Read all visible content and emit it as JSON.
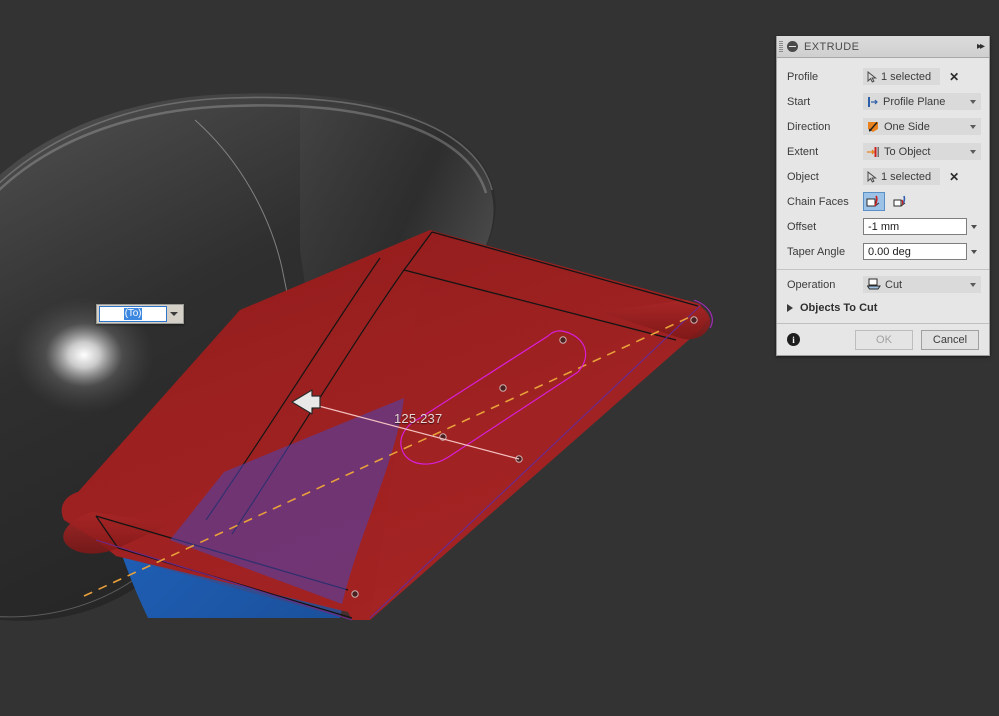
{
  "viewport": {
    "background_color": "#333333",
    "canvas_input": {
      "value": "(To)",
      "placeholder": "(To)",
      "dropdown_icon": "chevron-down-icon"
    },
    "dimension_label": "125.237",
    "manipulator": "arrow-left-handle",
    "colors": {
      "selected_face": "#1f61b5",
      "preview_body": "#9e2020",
      "profile_magenta": "#d81fd8",
      "axis_orange": "#e8a03a",
      "dimension_line": "#f4c0c0",
      "body_grey": "#3a3a3a"
    }
  },
  "panel": {
    "title": "EXTRUDE",
    "collapse_icon": "minus-circle-icon",
    "expand_icon": "double-chevron-right-icon",
    "grip_icon": "drag-grip-icon",
    "rows": [
      {
        "label": "Profile",
        "type": "selection",
        "value": "1 selected",
        "icon": "cursor-select-icon",
        "clear": "✕"
      },
      {
        "label": "Start",
        "type": "combo",
        "value": "Profile Plane",
        "icon": "profile-plane-icon"
      },
      {
        "label": "Direction",
        "type": "combo",
        "value": "One Side",
        "icon": "one-side-arrow-icon"
      },
      {
        "label": "Extent",
        "type": "combo",
        "value": "To Object",
        "icon": "to-object-icon"
      },
      {
        "label": "Object",
        "type": "selection",
        "value": "1 selected",
        "icon": "cursor-select-icon",
        "clear": "✕"
      },
      {
        "label": "Chain Faces",
        "type": "toggle",
        "options": [
          "chain-faces-on-icon",
          "chain-faces-off-icon"
        ],
        "selected_index": 0
      },
      {
        "label": "Offset",
        "type": "textbox",
        "value": "-1 mm"
      },
      {
        "label": "Taper Angle",
        "type": "textbox",
        "value": "0.00 deg"
      }
    ],
    "operation": {
      "label": "Operation",
      "value": "Cut",
      "icon": "cut-operation-icon"
    },
    "section": {
      "label": "Objects To Cut",
      "expanded": false,
      "icon": "triangle-right-icon"
    },
    "footer": {
      "info_icon": "info-icon",
      "info_glyph": "i",
      "ok_label": "OK",
      "ok_disabled": true,
      "cancel_label": "Cancel"
    }
  }
}
